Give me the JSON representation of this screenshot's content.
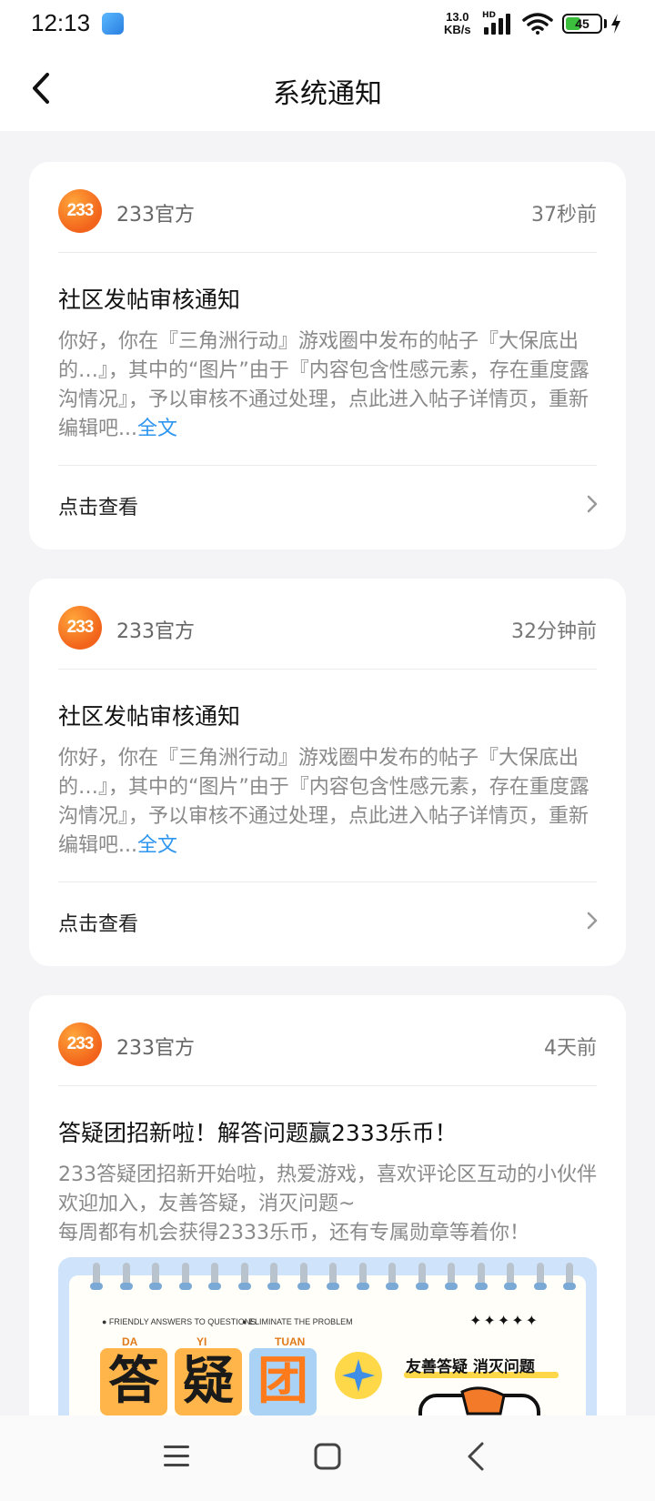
{
  "status_bar": {
    "time": "12:13",
    "net_speed_value": "13.0",
    "net_speed_unit": "KB/s",
    "hd": "HD",
    "battery": "45",
    "battery_level": 0.45
  },
  "nav": {
    "title": "系统通知"
  },
  "notifications": [
    {
      "avatar": "233",
      "sender": "233官方",
      "time": "37秒前",
      "title": "社区发帖审核通知",
      "body": "你好，你在『三角洲行动』游戏圈中发布的帖子『大保底出的…』，其中的“图片”由于『内容包含性感元素，存在重度露沟情况』，予以审核不通过处理，点此进入帖子详情页，重新编辑吧...",
      "full_link": "全文",
      "action": "点击查看"
    },
    {
      "avatar": "233",
      "sender": "233官方",
      "time": "32分钟前",
      "title": "社区发帖审核通知",
      "body": "你好，你在『三角洲行动』游戏圈中发布的帖子『大保底出的…』，其中的“图片”由于『内容包含性感元素，存在重度露沟情况』，予以审核不通过处理，点此进入帖子详情页，重新编辑吧...",
      "full_link": "全文",
      "action": "点击查看"
    },
    {
      "avatar": "233",
      "sender": "233官方",
      "time": "4天前",
      "title": "答疑团招新啦！解答问题赢2333乐币！",
      "body_line1": "233答疑团招新开始啦，热爱游戏，喜欢评论区互动的小伙伴欢迎加入，友善答疑，消灭问题~",
      "body_line2": "每周都有机会获得2333乐币，还有专属勋章等着你！",
      "banner": {
        "tag1": "● FRIENDLY ANSWERS TO QUESTIONS",
        "tag2": "● ELIMINATE THE PROBLEM",
        "pinyin1": "DA",
        "pinyin2": "YI",
        "pinyin3": "TUAN",
        "char1": "答",
        "char2": "疑",
        "char3": "团",
        "slogan": "友善答疑 消灭问题",
        "stars": "✦✦✦✦✦"
      }
    }
  ],
  "bottom_nav": {
    "menu": "menu-icon",
    "home": "square-icon",
    "back": "back-icon"
  }
}
